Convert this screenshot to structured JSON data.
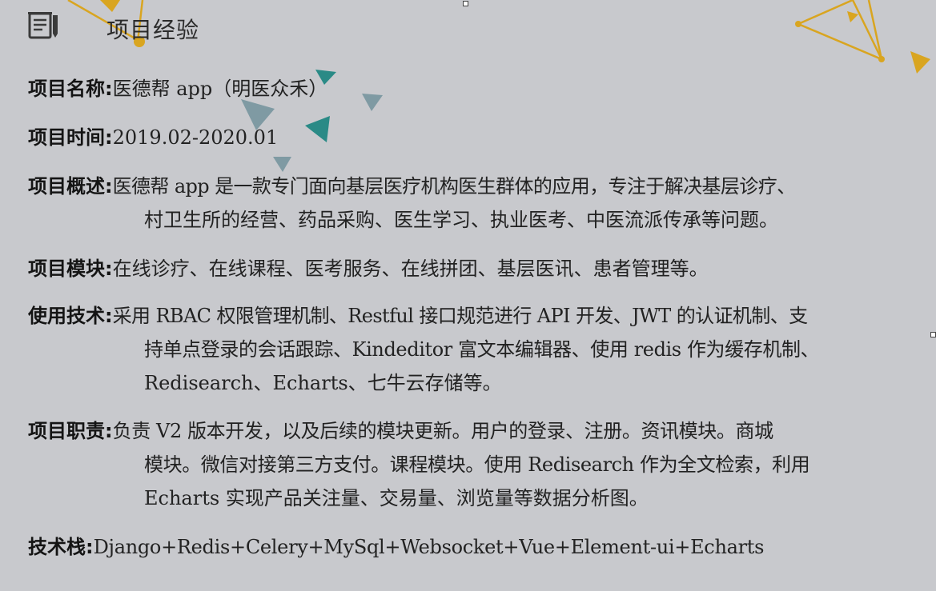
{
  "section": {
    "title": "项目经验",
    "icon": "document-icon"
  },
  "fields": {
    "name": {
      "label": "项目名称:",
      "value": "医德帮 app（明医众禾）"
    },
    "time": {
      "label": "项目时间:",
      "value": "2019.02-2020.01"
    },
    "overview": {
      "label": "项目概述:",
      "lines": [
        "医德帮 app 是一款专门面向基层医疗机构医生群体的应用，专注于解决基层诊疗、",
        "村卫生所的经营、药品采购、医生学习、执业医考、中医流派传承等问题。"
      ]
    },
    "modules": {
      "label": "项目模块:",
      "value": "在线诊疗、在线课程、医考服务、在线拼团、基层医讯、患者管理等。"
    },
    "tech": {
      "label": "使用技术:",
      "lines": [
        "采用 RBAC 权限管理机制、Restful 接口规范进行 API 开发、JWT 的认证机制、支",
        "持单点登录的会话跟踪、Kindeditor 富文本编辑器、使用 redis 作为缓存机制、",
        "Redisearch、Echarts、七牛云存储等。"
      ]
    },
    "duties": {
      "label": "项目职责:",
      "lines": [
        "负责 V2 版本开发，以及后续的模块更新。用户的登录、注册。资讯模块。商城",
        "模块。微信对接第三方支付。课程模块。使用 Redisearch 作为全文检索，利用",
        "Echarts 实现产品关注量、交易量、浏览量等数据分析图。"
      ]
    },
    "stack": {
      "label": "技术栈:",
      "value": "Django+Redis+Celery+MySql+Websocket+Vue+Element-ui+Echarts"
    }
  },
  "colors": {
    "background": "#c8c9cd",
    "gold": "#d9a520",
    "teal": "#2a8a86",
    "slate": "#7f9aa3"
  }
}
